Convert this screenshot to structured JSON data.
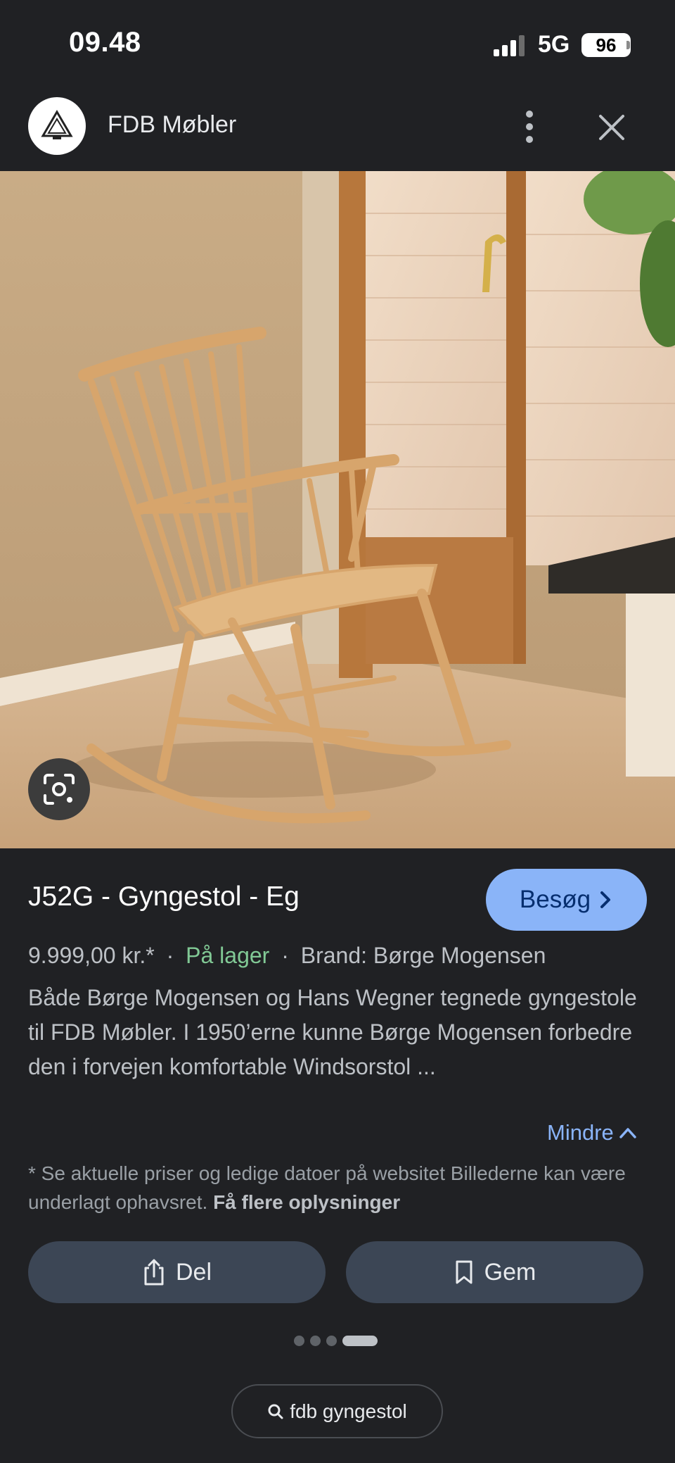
{
  "status_bar": {
    "time": "09.48",
    "network": "5G",
    "battery": "96"
  },
  "header": {
    "site_name": "FDB Møbler"
  },
  "result": {
    "title": "J52G - Gyngestol - Eg",
    "visit_label": "Besøg",
    "price": "9.999,00 kr.*",
    "stock": "På lager",
    "brand": "Brand: Børge Mogensen",
    "separator": "·",
    "description": "Både Børge Mogensen og Hans Wegner tegnede gyngestole til FDB Møbler. I 1950’erne kunne Børge Mogensen forbedre den i forvejen komfortable Windsorstol ...",
    "less_label": "Mindre",
    "note_text": "* Se aktuelle priser og ledige datoer på websitet Billederne kan være underlagt ophavsret.",
    "note_link": "Få flere oplysninger"
  },
  "actions": {
    "share_label": "Del",
    "save_label": "Gem"
  },
  "pagination": {
    "count": 4,
    "active_index": 3
  },
  "search": {
    "query": "fdb gyngestol"
  },
  "colors": {
    "background": "#202124",
    "accent": "#8ab4f8",
    "stock": "#81c995",
    "button": "#3c4655"
  },
  "icons": {
    "signal": "signal-icon",
    "more": "more-vert-icon",
    "close": "close-icon",
    "lens": "lens-icon",
    "chevron_right": "chevron-right-icon",
    "chevron_up": "chevron-up-icon",
    "share": "share-icon",
    "bookmark": "bookmark-icon",
    "search": "search-icon"
  }
}
